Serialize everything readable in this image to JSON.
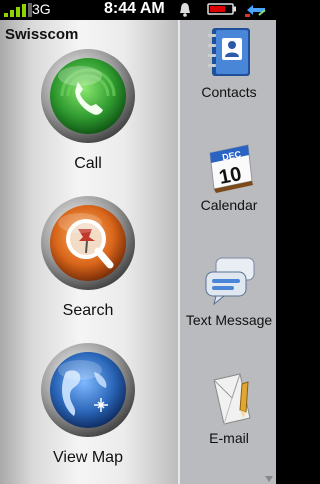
{
  "status_bar": {
    "network": "3G",
    "time": "8:44 AM",
    "icons": [
      "signal-bars-icon",
      "bell-icon",
      "battery-icon",
      "sync-icon"
    ]
  },
  "left_pane": {
    "title": "Swisscom",
    "buttons": [
      {
        "label": "Call",
        "icon": "phone-handset-icon"
      },
      {
        "label": "Search",
        "icon": "pushpin-magnifier-icon"
      },
      {
        "label": "View Map",
        "icon": "globe-icon"
      }
    ]
  },
  "right_pane": {
    "apps": [
      {
        "label": "Contacts",
        "icon": "address-book-icon"
      },
      {
        "label": "Calendar",
        "icon": "calendar-icon",
        "month": "DEC",
        "day": "10"
      },
      {
        "label": "Text Message",
        "icon": "speech-bubbles-icon"
      },
      {
        "label": "E-mail",
        "icon": "envelope-icon"
      }
    ]
  },
  "colors": {
    "call_green": "#3aa33a",
    "search_orange": "#d8651a",
    "map_blue": "#2a66b8",
    "signal_green": "#8fd400"
  }
}
